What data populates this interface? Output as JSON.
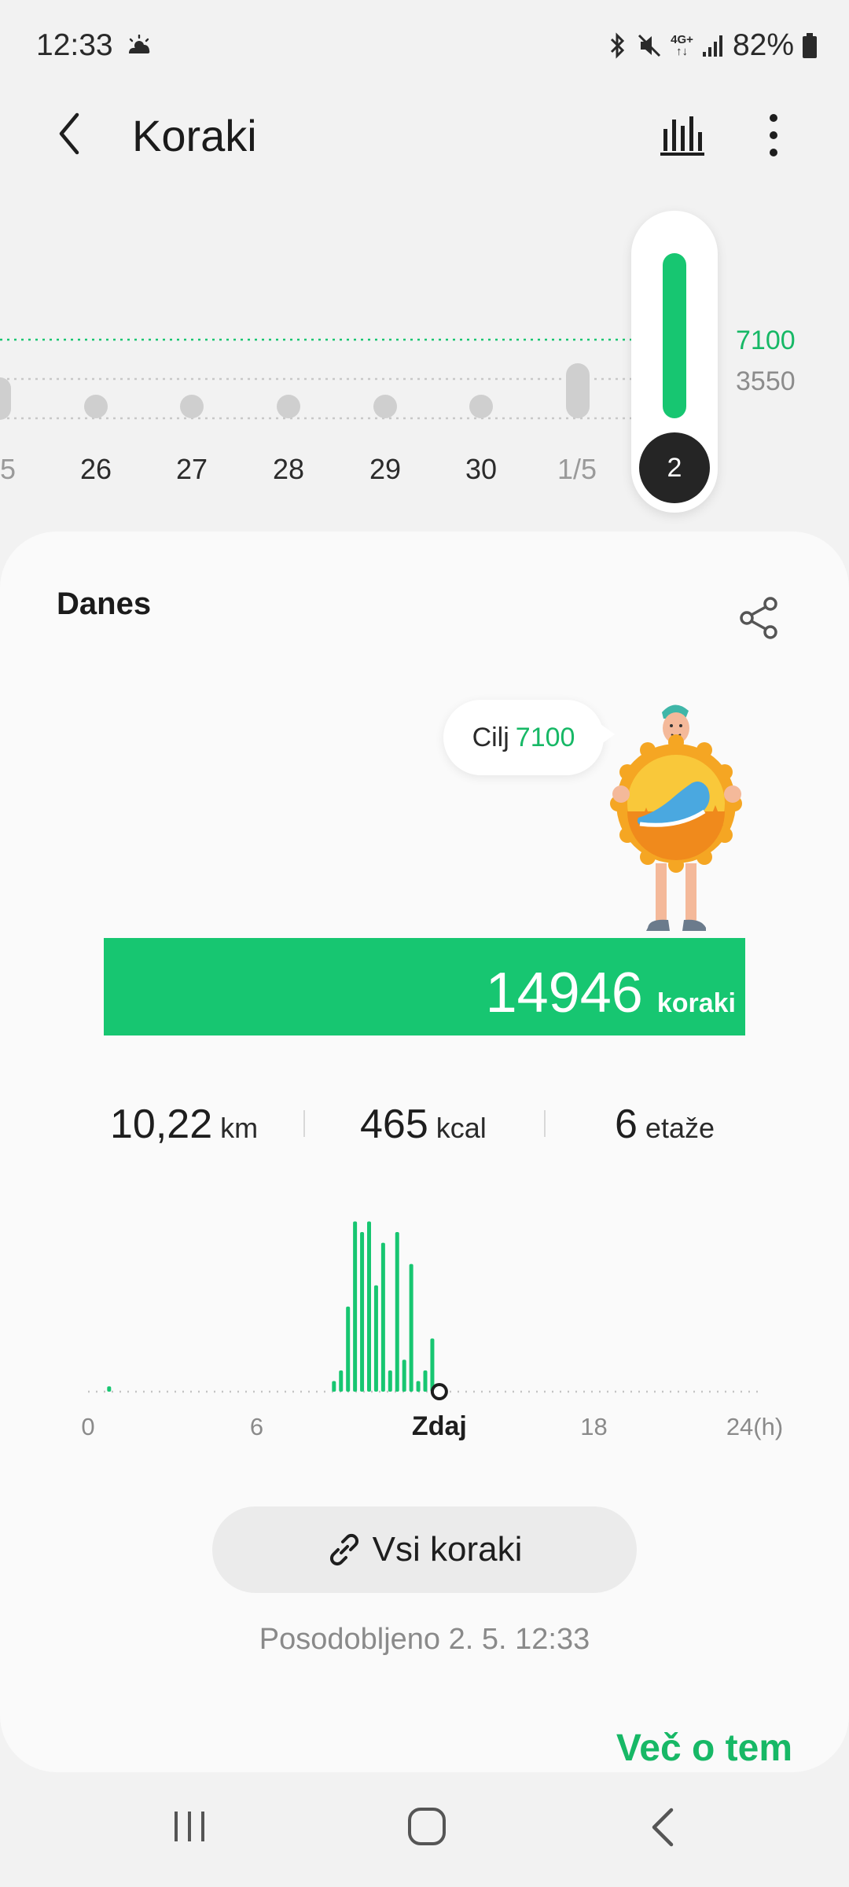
{
  "status_bar": {
    "time": "12:33",
    "battery": "82%",
    "network": "4G+",
    "weather_icon": "sun-cloud-icon"
  },
  "app_bar": {
    "title": "Koraki"
  },
  "day_strip": {
    "days": [
      {
        "label": "5",
        "faded": true
      },
      {
        "label": "26",
        "faded": false
      },
      {
        "label": "27",
        "faded": false
      },
      {
        "label": "28",
        "faded": false
      },
      {
        "label": "29",
        "faded": false
      },
      {
        "label": "30",
        "faded": false
      },
      {
        "label": "1/5",
        "faded": true
      }
    ],
    "selected_day": "2",
    "goal_line_label": "7100",
    "half_line_label": "3550",
    "accent": "#17c671"
  },
  "card": {
    "title": "Danes",
    "goal_label": "Cilj",
    "goal_value": "7100",
    "steps_value": "14946",
    "steps_unit": "koraki",
    "stats": [
      {
        "value": "10,22",
        "unit": "km"
      },
      {
        "value": "465",
        "unit": "kcal"
      },
      {
        "value": "6",
        "unit": "etaže"
      }
    ],
    "all_steps_label": "Vsi koraki",
    "updated_text": "Posodobljeno 2. 5. 12:33",
    "more_link": "Več o tem"
  },
  "chart_data": {
    "type": "bar",
    "xlabel": "",
    "ylabel": "",
    "x_tick_labels": [
      "0",
      "6",
      "Zdaj",
      "18",
      "24(h)"
    ],
    "x_range": [
      0,
      24
    ],
    "now_hour": 12.5,
    "series": [
      {
        "x": [
          0.75,
          8.75,
          9.0,
          9.25,
          9.5,
          9.75,
          10.0,
          10.25,
          10.5,
          10.75,
          11.0,
          11.25,
          11.5,
          11.75,
          12.0,
          12.25
        ],
        "values": [
          1,
          2,
          4,
          16,
          32,
          30,
          32,
          20,
          28,
          4,
          30,
          6,
          24,
          2,
          4,
          10
        ]
      }
    ],
    "ylim": [
      0,
      34
    ]
  },
  "nav_bar": {
    "items": [
      "recent-apps-icon",
      "home-icon",
      "back-icon"
    ]
  }
}
